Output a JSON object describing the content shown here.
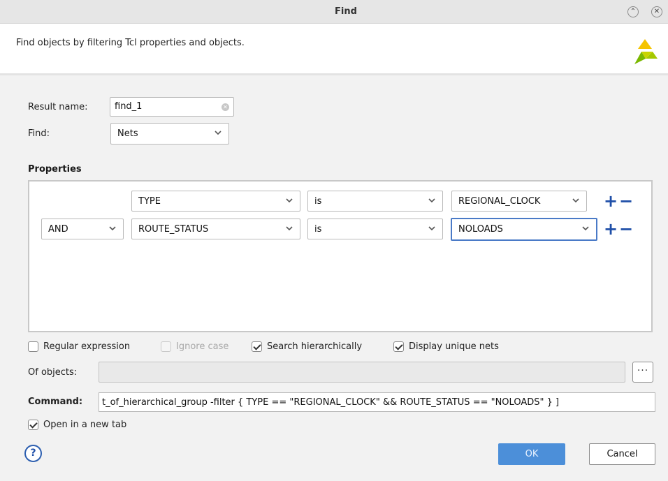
{
  "window": {
    "title": "Find",
    "collapse_glyph": "⌃",
    "close_glyph": "✕"
  },
  "header": {
    "description": "Find objects by filtering Tcl properties and objects."
  },
  "form": {
    "result_name_label": "Result name:",
    "result_name_value": "find_1",
    "find_label": "Find:",
    "find_value": "Nets"
  },
  "properties": {
    "title": "Properties",
    "rows": [
      {
        "logic": "",
        "property": "TYPE",
        "operator": "is",
        "value": "REGIONAL_CLOCK"
      },
      {
        "logic": "AND",
        "property": "ROUTE_STATUS",
        "operator": "is",
        "value": "NOLOADS"
      }
    ],
    "add_glyph": "+",
    "remove_glyph": "−"
  },
  "options": {
    "regular_expression": {
      "label": "Regular expression",
      "checked": false
    },
    "ignore_case": {
      "label": "Ignore case",
      "checked": false,
      "disabled": true
    },
    "search_hierarchically": {
      "label": "Search hierarchically",
      "checked": true
    },
    "display_unique_nets": {
      "label": "Display unique nets",
      "checked": true
    }
  },
  "objects": {
    "label": "Of objects:",
    "value": "",
    "browse_label": "···"
  },
  "command": {
    "label": "Command:",
    "value": "t_of_hierarchical_group -filter { TYPE == \"REGIONAL_CLOCK\" && ROUTE_STATUS == \"NOLOADS\" } ]"
  },
  "footer": {
    "open_new_tab": {
      "label": "Open in a new tab",
      "checked": true
    },
    "help_glyph": "?",
    "ok_label": "OK",
    "cancel_label": "Cancel"
  },
  "colors": {
    "accent": "#4c8fd9",
    "add_remove": "#1f4fa8",
    "logo_yellow": "#f5c400",
    "logo_green": "#7ab800"
  },
  "icons": [
    "collapse-icon",
    "close-icon",
    "app-logo",
    "clear-icon",
    "chevron-down-icon",
    "plus-icon",
    "minus-icon",
    "help-icon",
    "ellipsis-icon"
  ]
}
